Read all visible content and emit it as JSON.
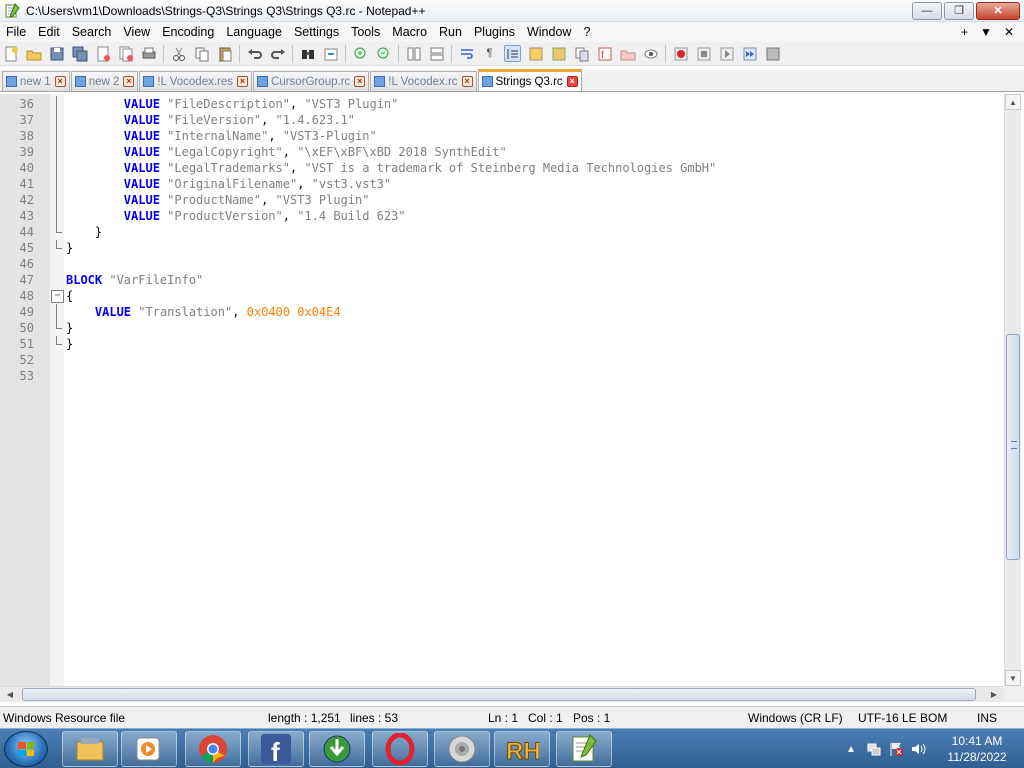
{
  "window": {
    "title": "C:\\Users\\vm1\\Downloads\\Strings-Q3\\Strings Q3\\Strings Q3.rc - Notepad++",
    "minimize": "—",
    "maximize": "❐",
    "close": "✕"
  },
  "menu": {
    "items": [
      "File",
      "Edit",
      "Search",
      "View",
      "Encoding",
      "Language",
      "Settings",
      "Tools",
      "Macro",
      "Run",
      "Plugins",
      "Window",
      "?"
    ],
    "right": [
      "+",
      "▼",
      "✕"
    ]
  },
  "tabs": [
    {
      "label": "new 1",
      "active": false
    },
    {
      "label": "new 2",
      "active": false
    },
    {
      "label": "!L Vocodex.res",
      "active": false
    },
    {
      "label": "CursorGroup.rc",
      "active": false
    },
    {
      "label": "!L Vocodex.rc",
      "active": false
    },
    {
      "label": "Strings Q3.rc",
      "active": true
    }
  ],
  "editor": {
    "lines": [
      {
        "num": "36",
        "fold": "v",
        "indent": "        ",
        "kw": "VALUE",
        "a": "\"FileDescription\"",
        "b": "\"VST3 Plugin\""
      },
      {
        "num": "37",
        "fold": "v",
        "indent": "        ",
        "kw": "VALUE",
        "a": "\"FileVersion\"",
        "b": "\"1.4.623.1\""
      },
      {
        "num": "38",
        "fold": "v",
        "indent": "        ",
        "kw": "VALUE",
        "a": "\"InternalName\"",
        "b": "\"VST3-Plugin\""
      },
      {
        "num": "39",
        "fold": "v",
        "indent": "        ",
        "kw": "VALUE",
        "a": "\"LegalCopyright\"",
        "b": "\"\\xEF\\xBF\\xBD 2018 SynthEdit\""
      },
      {
        "num": "40",
        "fold": "v",
        "indent": "        ",
        "kw": "VALUE",
        "a": "\"LegalTrademarks\"",
        "b": "\"VST is a trademark of Steinberg Media Technologies GmbH\""
      },
      {
        "num": "41",
        "fold": "v",
        "indent": "        ",
        "kw": "VALUE",
        "a": "\"OriginalFilename\"",
        "b": "\"vst3.vst3\""
      },
      {
        "num": "42",
        "fold": "v",
        "indent": "        ",
        "kw": "VALUE",
        "a": "\"ProductName\"",
        "b": "\"VST3 Plugin\""
      },
      {
        "num": "43",
        "fold": "v",
        "indent": "        ",
        "kw": "VALUE",
        "a": "\"ProductVersion\"",
        "b": "\"1.4 Build 623\""
      },
      {
        "num": "44",
        "fold": "end",
        "text": "    }"
      },
      {
        "num": "45",
        "fold": "end",
        "text": "}"
      },
      {
        "num": "46",
        "fold": "",
        "text": ""
      },
      {
        "num": "47",
        "fold": "",
        "kw": "BLOCK",
        "a": "\"VarFileInfo\"",
        "indent": ""
      },
      {
        "num": "48",
        "fold": "box",
        "text": "{"
      },
      {
        "num": "49",
        "fold": "v",
        "indent": "    ",
        "kw": "VALUE",
        "a": "\"Translation\"",
        "n1": "0x0400",
        "n2": "0x04E4"
      },
      {
        "num": "50",
        "fold": "end",
        "text": "}"
      },
      {
        "num": "51",
        "fold": "end",
        "text": "}"
      },
      {
        "num": "52",
        "fold": "",
        "text": ""
      },
      {
        "num": "53",
        "fold": "",
        "text": ""
      }
    ]
  },
  "status": {
    "file_type": "Windows Resource file",
    "length": "length : 1,251",
    "lines": "lines : 53",
    "ln": "Ln : 1",
    "col": "Col : 1",
    "pos": "Pos : 1",
    "eol": "Windows (CR LF)",
    "encoding": "UTF-16 LE BOM",
    "mode": "INS"
  },
  "taskbar": {
    "clock_time": "10:41 AM",
    "clock_date": "11/28/2022",
    "apps": [
      "file-explorer",
      "media-player",
      "chrome",
      "facebook",
      "download-manager",
      "opera",
      "speaker-app",
      "rh-app",
      "notepadpp"
    ]
  },
  "colors": {
    "keyword": "#0000ff",
    "string": "#808080",
    "number": "#ff8000",
    "active_tab_accent": "#f0a436"
  }
}
